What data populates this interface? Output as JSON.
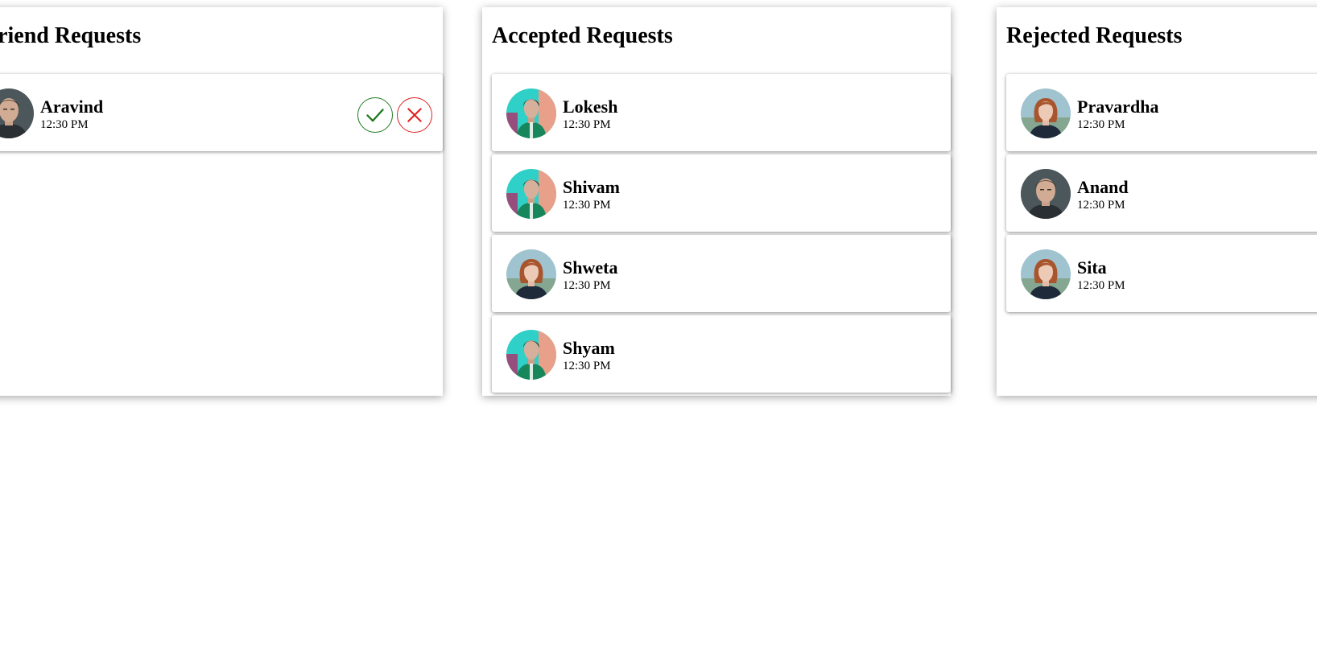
{
  "colors": {
    "accept": "#1f7a1f",
    "reject": "#e02020"
  },
  "pending": {
    "title": "Friend Requests",
    "items": [
      {
        "name": "Aravind",
        "time": "12:30 PM",
        "avatar": "man-dark-portrait"
      }
    ],
    "accept_icon": "check-icon",
    "reject_icon": "close-icon"
  },
  "accepted": {
    "title": "Accepted Requests",
    "items": [
      {
        "name": "Lokesh",
        "time": "12:30 PM",
        "avatar": "man-teal-portrait"
      },
      {
        "name": "Shivam",
        "time": "12:30 PM",
        "avatar": "man-teal-portrait"
      },
      {
        "name": "Shweta",
        "time": "12:30 PM",
        "avatar": "woman-redhead-portrait"
      },
      {
        "name": "Shyam",
        "time": "12:30 PM",
        "avatar": "man-teal-portrait"
      }
    ]
  },
  "rejected": {
    "title": "Rejected Requests",
    "items": [
      {
        "name": "Pravardha",
        "time": "12:30 PM",
        "avatar": "woman-redhead-portrait"
      },
      {
        "name": "Anand",
        "time": "12:30 PM",
        "avatar": "man-dark-portrait"
      },
      {
        "name": "Sita",
        "time": "12:30 PM",
        "avatar": "woman-redhead-portrait"
      }
    ]
  }
}
